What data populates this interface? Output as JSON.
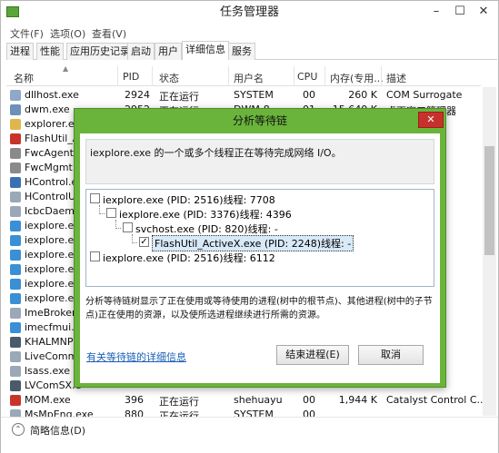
{
  "window": {
    "title": "任务管理器",
    "min": "–",
    "max": "☐",
    "close": "✕"
  },
  "menu": [
    "文件(F)",
    "选项(O)",
    "查看(V)"
  ],
  "tabs": [
    "进程",
    "性能",
    "应用历史记录",
    "启动",
    "用户",
    "详细信息",
    "服务"
  ],
  "active_tab": "详细信息",
  "table": {
    "columns": [
      "名称",
      "PID",
      "状态",
      "用户名",
      "CPU",
      "内存(专用...",
      "描述"
    ],
    "rows": [
      {
        "name": "dllhost.exe",
        "pid": "2924",
        "status": "正在运行",
        "user": "SYSTEM",
        "cpu": "00",
        "mem": "260 K",
        "desc": "COM Surrogate",
        "icon_color": "#8fa7c9"
      },
      {
        "name": "dwm.exe",
        "pid": "2952",
        "status": "正在运行",
        "user": "DWM-8",
        "cpu": "01",
        "mem": "15,640 K",
        "desc": "桌面窗口管理器",
        "icon_color": "#6d8fb8"
      },
      {
        "name": "explorer.exe",
        "pid": "",
        "status": "",
        "user": "",
        "cpu": "",
        "mem": "",
        "desc": "管理器",
        "icon_color": "#e0b64b"
      },
      {
        "name": "FlashUtil_Ac",
        "pid": "",
        "status": "",
        "user": "",
        "cpu": "",
        "mem": "",
        "desc": "Ac...",
        "icon_color": "#c9342a"
      },
      {
        "name": "FwcAgent.ex",
        "pid": "",
        "status": "",
        "user": "",
        "cpu": "",
        "mem": "",
        "desc": "S Cli...",
        "icon_color": "#8a8a8a"
      },
      {
        "name": "FwcMgmt.ex",
        "pid": "",
        "status": "",
        "user": "",
        "cpu": "",
        "mem": "",
        "desc": "S Cli...",
        "icon_color": "#8a8a8a"
      },
      {
        "name": "HControl.ex",
        "pid": "",
        "status": "",
        "user": "",
        "cpu": "",
        "mem": "",
        "desc": "",
        "icon_color": "#3b6fb4"
      },
      {
        "name": "HControlUs",
        "pid": "",
        "status": "",
        "user": "",
        "cpu": "",
        "mem": "",
        "desc": "",
        "icon_color": "#9aa8b8"
      },
      {
        "name": "IcbcDaemo",
        "pid": "",
        "status": "",
        "user": "",
        "cpu": "",
        "mem": "",
        "desc": "",
        "icon_color": "#9aa8b8"
      },
      {
        "name": "iexplore.exe",
        "pid": "",
        "status": "",
        "user": "",
        "cpu": "",
        "mem": "",
        "desc": "rer",
        "icon_color": "#3a8fd6"
      },
      {
        "name": "iexplore.exe",
        "pid": "",
        "status": "",
        "user": "",
        "cpu": "",
        "mem": "",
        "desc": "rer",
        "icon_color": "#3a8fd6"
      },
      {
        "name": "iexplore.exe",
        "pid": "",
        "status": "",
        "user": "",
        "cpu": "",
        "mem": "",
        "desc": "rer",
        "icon_color": "#3a8fd6"
      },
      {
        "name": "iexplore.exe",
        "pid": "",
        "status": "",
        "user": "",
        "cpu": "",
        "mem": "",
        "desc": "rer",
        "icon_color": "#3a8fd6"
      },
      {
        "name": "iexplore.exe",
        "pid": "",
        "status": "",
        "user": "",
        "cpu": "",
        "mem": "",
        "desc": "rer",
        "icon_color": "#3a8fd6"
      },
      {
        "name": "iexplore.exe",
        "pid": "",
        "status": "",
        "user": "",
        "cpu": "",
        "mem": "",
        "desc": "rer",
        "icon_color": "#3a8fd6"
      },
      {
        "name": "ImeBroker.",
        "pid": "",
        "status": "",
        "user": "",
        "cpu": "",
        "mem": "",
        "desc": "2012",
        "icon_color": "#9aa8b8"
      },
      {
        "name": "imecfmui.ex",
        "pid": "",
        "status": "",
        "user": "",
        "cpu": "",
        "mem": "",
        "desc": "2012",
        "icon_color": "#3a8fd6"
      },
      {
        "name": "KHALMNPR",
        "pid": "",
        "status": "",
        "user": "",
        "cpu": "",
        "mem": "",
        "desc": "Ma...",
        "icon_color": "#4a5a6a"
      },
      {
        "name": "LiveComm.",
        "pid": "",
        "status": "",
        "user": "",
        "cpu": "",
        "mem": "",
        "desc": "ns Sy...",
        "icon_color": "#9aa8b8"
      },
      {
        "name": "lsass.exe",
        "pid": "",
        "status": "",
        "user": "",
        "cpu": "",
        "mem": "",
        "desc": "ut...",
        "icon_color": "#9aa8b8"
      },
      {
        "name": "LVComSX.e",
        "pid": "",
        "status": "",
        "user": "",
        "cpu": "",
        "mem": "",
        "desc": "",
        "icon_color": "#4a5a6a"
      },
      {
        "name": "MOM.exe",
        "pid": "396",
        "status": "正在运行",
        "user": "shehuayu",
        "cpu": "00",
        "mem": "1,944 K",
        "desc": "Catalyst Control C...",
        "icon_color": "#c9342a"
      },
      {
        "name": "MsMpEng.exe",
        "pid": "880",
        "status": "正在运行",
        "user": "SYSTEM",
        "cpu": "00",
        "mem": "",
        "desc": "",
        "icon_color": "#9aa8b8"
      }
    ]
  },
  "footer": {
    "fewer_details": "简略信息(D)"
  },
  "dialog": {
    "title": "分析等待链",
    "close": "✕",
    "message": "iexplore.exe 的一个或多个线程正在等待完成网络 I/O。",
    "tree": [
      {
        "label": "iexplore.exe (PID: 2516)线程: 7708",
        "checked": false
      },
      {
        "label": "iexplore.exe (PID: 3376)线程: 4396",
        "checked": false
      },
      {
        "label": "svchost.exe (PID: 820)线程: -",
        "checked": false
      },
      {
        "label": "FlashUtil_ActiveX.exe (PID: 2248)线程: -",
        "checked": true,
        "check_mark": "✓"
      },
      {
        "label": "iexplore.exe (PID: 2516)线程: 6112",
        "checked": false
      }
    ],
    "description": "分析等待链树显示了正在使用或等待使用的进程(树中的根节点)、其他进程(树中的子节点)正在使用的资源，以及使所选进程继续进行所需的资源。",
    "link": "有关等待链的详细信息",
    "end_process": "结束进程(E)",
    "cancel": "取消"
  }
}
